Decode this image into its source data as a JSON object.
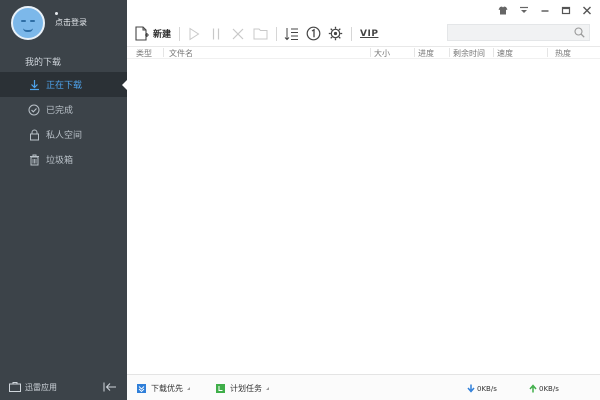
{
  "sidebar": {
    "login": "点击登录",
    "section_title": "我的下载",
    "items": [
      {
        "label": "正在下载",
        "icon": "download-icon",
        "active": true
      },
      {
        "label": "已完成",
        "icon": "check-circle-icon",
        "active": false
      },
      {
        "label": "私人空间",
        "icon": "lock-icon",
        "active": false
      },
      {
        "label": "垃圾箱",
        "icon": "trash-icon",
        "active": false
      }
    ],
    "bottom_label": "迅雷应用"
  },
  "toolbar": {
    "new_label": "新建",
    "vip_label": "VIP",
    "search_placeholder": ""
  },
  "table": {
    "columns": [
      "类型",
      "文件名",
      "大小",
      "进度",
      "剩余时间",
      "速度",
      "热度"
    ]
  },
  "statusbar": {
    "priority_label": "下载优先",
    "schedule_label": "计划任务",
    "down_speed": "0KB/s",
    "up_speed": "0KB/s"
  },
  "colors": {
    "sidebar_bg": "#3c4349",
    "active_bg": "#2b3136",
    "accent": "#4ea3ec",
    "down_arrow": "#2f7fd9",
    "up_arrow": "#3fae49"
  }
}
